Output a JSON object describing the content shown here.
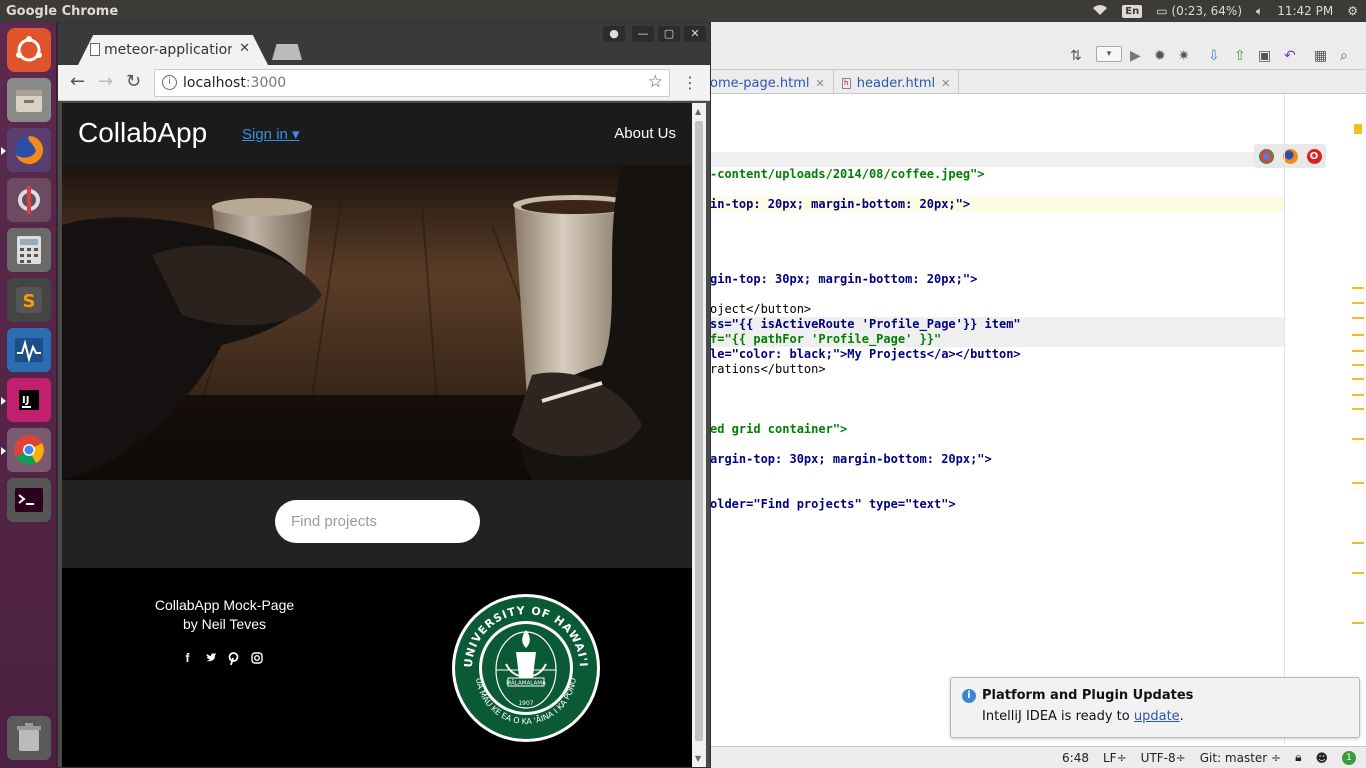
{
  "top_panel": {
    "app_title": "Google Chrome",
    "keyboard": "En",
    "battery": "(0:23, 64%)",
    "clock": "11:42 PM"
  },
  "chrome": {
    "tab_title": "meteor-application",
    "url_host": "localhost",
    "url_port": ":3000"
  },
  "site": {
    "brand": "CollabApp",
    "signin": "Sign in ▾",
    "about": "About Us",
    "search_placeholder": "Find projects",
    "footer_line1": "CollabApp Mock-Page",
    "footer_line2": "by Neil Teves",
    "seal_outer_text": "UNIVERSITY OF HAWAI'I",
    "seal_inner_text": "UA MAU KE EA O KA 'ĀINA I KA PONO",
    "seal_motto": "MĀLAMALAMA",
    "seal_year": "1907"
  },
  "ide": {
    "tabs": [
      {
        "label": "ome-page.html"
      },
      {
        "label": "header.html"
      }
    ],
    "code_lines": [
      {
        "text": "-content/uploads/2014/08/coffee.jpeg\">"
      },
      {
        "text": "in-top: 20px; margin-bottom: 20px;\">"
      },
      {
        "text": "gin-top: 30px; margin-bottom: 20px;\">"
      },
      {
        "text": "oject</button>"
      },
      {
        "text": "ss=\"{{ isActiveRoute 'Profile_Page'}} item\""
      },
      {
        "text": "f=\"{{ pathFor 'Profile_Page' }}\""
      },
      {
        "text": "le=\"color: black;\">My Projects</a></button>"
      },
      {
        "text": "rations</button>"
      },
      {
        "text": "ed grid container\">"
      },
      {
        "text": "argin-top: 30px; margin-bottom: 20px;\">"
      },
      {
        "text": "older=\"Find projects\" type=\"text\">"
      }
    ],
    "notification": {
      "title": "Platform and Plugin Updates",
      "body": "IntelliJ IDEA is ready to ",
      "link": "update",
      "trail": "."
    },
    "status": {
      "position": "6:48",
      "line_sep": "LF÷",
      "encoding": "UTF-8÷",
      "vcs": "Git: master ÷"
    }
  },
  "icons": [
    "ubuntu-icon",
    "files-icon",
    "firefox-icon",
    "settings-icon",
    "calculator-icon",
    "sublime-icon",
    "monitor-icon",
    "intellij-icon",
    "chrome-icon",
    "terminal-icon",
    "trash-icon",
    "facebook-icon",
    "twitter-icon",
    "pinterest-icon",
    "instagram-icon"
  ]
}
